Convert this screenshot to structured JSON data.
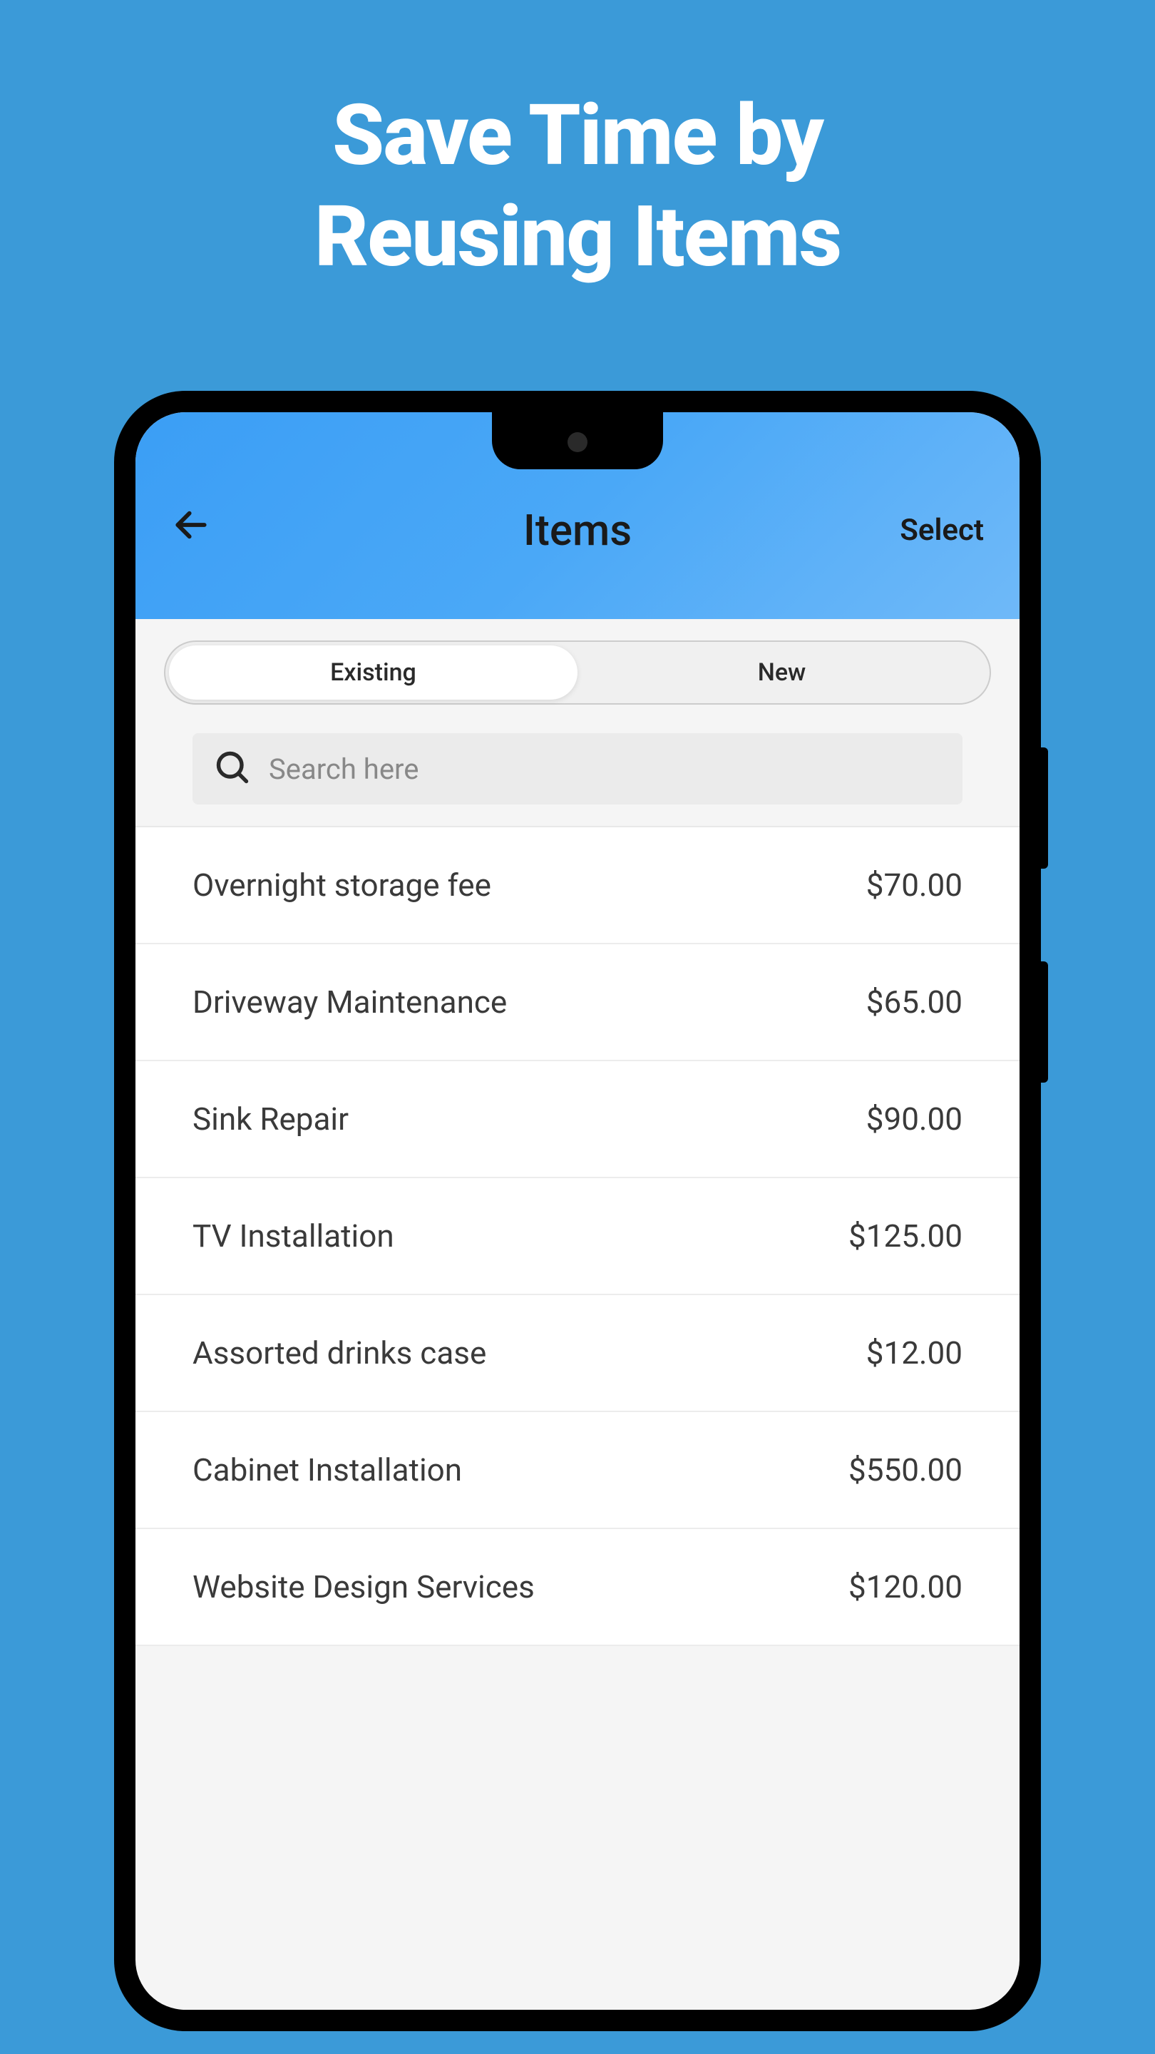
{
  "hero": {
    "title_line1": "Save Time by",
    "title_line2": "Reusing Items"
  },
  "header": {
    "title": "Items",
    "select_label": "Select"
  },
  "tabs": {
    "existing": "Existing",
    "new": "New"
  },
  "search": {
    "placeholder": "Search here"
  },
  "items": [
    {
      "name": "Overnight storage fee",
      "price": "$70.00"
    },
    {
      "name": "Driveway Maintenance",
      "price": "$65.00"
    },
    {
      "name": "Sink Repair",
      "price": "$90.00"
    },
    {
      "name": "TV Installation",
      "price": "$125.00"
    },
    {
      "name": "Assorted drinks case",
      "price": "$12.00"
    },
    {
      "name": "Cabinet Installation",
      "price": "$550.00"
    },
    {
      "name": "Website Design Services",
      "price": "$120.00"
    }
  ]
}
